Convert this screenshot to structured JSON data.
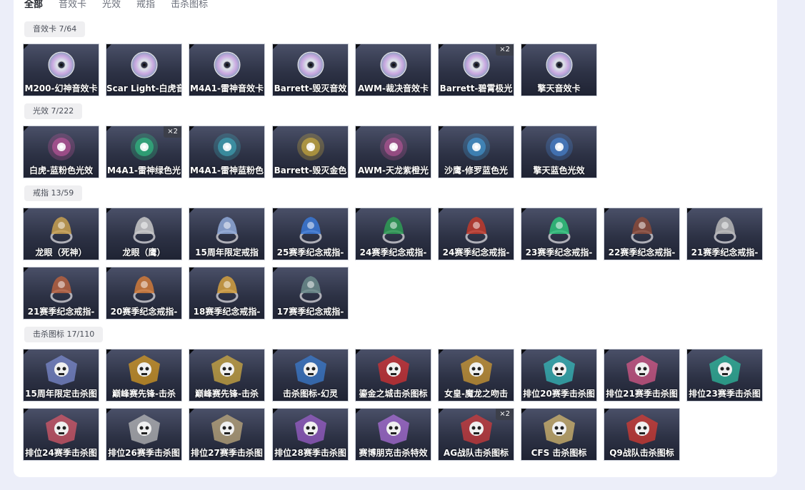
{
  "tabs": [
    {
      "label": "全部",
      "active": true
    },
    {
      "label": "音效卡",
      "active": false
    },
    {
      "label": "光效",
      "active": false
    },
    {
      "label": "戒指",
      "active": false
    },
    {
      "label": "击杀图标",
      "active": false
    }
  ],
  "sections": [
    {
      "label": "音效卡 7/64",
      "kind": "disc",
      "items": [
        {
          "name": "M200-幻神音效卡",
          "qty": ""
        },
        {
          "name": "Scar Light-白虎音",
          "qty": ""
        },
        {
          "name": "M4A1-雷神音效卡",
          "qty": ""
        },
        {
          "name": "Barrett-毁灭音效",
          "qty": ""
        },
        {
          "name": "AWM-裁决音效卡",
          "qty": ""
        },
        {
          "name": "Barrett-碧霄极光",
          "qty": "×2"
        },
        {
          "name": "擎天音效卡",
          "qty": ""
        }
      ]
    },
    {
      "label": "光效 7/222",
      "kind": "orb",
      "items": [
        {
          "name": "白虎-蓝粉色光效",
          "qty": "",
          "color": "#d45aa8"
        },
        {
          "name": "M4A1-雷神绿色光",
          "qty": "×2",
          "color": "#2fd28a"
        },
        {
          "name": "M4A1-雷神蓝粉色",
          "qty": "",
          "color": "#3fb7c9"
        },
        {
          "name": "Barrett-毁灭金色",
          "qty": "",
          "color": "#e6c03a"
        },
        {
          "name": "AWM-天龙紫橙光",
          "qty": "",
          "color": "#c95aa0"
        },
        {
          "name": "沙鹰-修罗蓝色光",
          "qty": "",
          "color": "#45a6e8"
        },
        {
          "name": "擎天蓝色光效",
          "qty": "",
          "color": "#4c8fe6"
        }
      ]
    },
    {
      "label": "戒指 13/59",
      "kind": "ring",
      "items": [
        {
          "name": "龙眼（死神）",
          "qty": "",
          "color": "#c8a050"
        },
        {
          "name": "龙眼（鹰）",
          "qty": "",
          "color": "#c9c9c9"
        },
        {
          "name": "15周年限定戒指",
          "qty": "",
          "color": "#8fa9d8"
        },
        {
          "name": "25赛季纪念戒指-",
          "qty": "",
          "color": "#3a78d6"
        },
        {
          "name": "24赛季纪念戒指-",
          "qty": "",
          "color": "#2e9c55"
        },
        {
          "name": "24赛季纪念戒指-",
          "qty": "",
          "color": "#c0392b"
        },
        {
          "name": "23赛季纪念戒指-",
          "qty": "",
          "color": "#2ec27a"
        },
        {
          "name": "22赛季纪念戒指-",
          "qty": "",
          "color": "#8a4a3a"
        },
        {
          "name": "21赛季纪念戒指-",
          "qty": "",
          "color": "#b8b8b8"
        },
        {
          "name": "21赛季纪念戒指-",
          "qty": "",
          "color": "#b5603f"
        },
        {
          "name": "20赛季纪念戒指-",
          "qty": "",
          "color": "#d07a3a"
        },
        {
          "name": "18赛季纪念戒指-",
          "qty": "",
          "color": "#d4a040"
        },
        {
          "name": "17赛季纪念戒指-",
          "qty": "",
          "color": "#6a8a8a"
        }
      ]
    },
    {
      "label": "击杀图标 17/110",
      "kind": "emblem",
      "items": [
        {
          "name": "15周年限定击杀图",
          "qty": "",
          "color": "#7f8fd6"
        },
        {
          "name": "巅峰赛先锋-击杀",
          "qty": "",
          "color": "#e0a020"
        },
        {
          "name": "巅峰赛先锋-击杀",
          "qty": "",
          "color": "#d8b040"
        },
        {
          "name": "击杀图标-幻灵",
          "qty": "",
          "color": "#3a7fd6"
        },
        {
          "name": "鎏金之城击杀图标",
          "qty": "",
          "color": "#e03030"
        },
        {
          "name": "女皇-魔龙之吻击",
          "qty": "",
          "color": "#d8a030"
        },
        {
          "name": "排位20赛季击杀图",
          "qty": "",
          "color": "#36c2c2"
        },
        {
          "name": "排位21赛季击杀图",
          "qty": "",
          "color": "#e05a8a"
        },
        {
          "name": "排位23赛季击杀图",
          "qty": "",
          "color": "#2ec2a2"
        },
        {
          "name": "排位24赛季击杀图",
          "qty": "",
          "color": "#e05a6a"
        },
        {
          "name": "排位26赛季击杀图",
          "qty": "",
          "color": "#c0c0c0"
        },
        {
          "name": "排位27赛季击杀图",
          "qty": "",
          "color": "#c8b080"
        },
        {
          "name": "排位28赛季击杀图",
          "qty": "",
          "color": "#a060d0"
        },
        {
          "name": "赛博朋克击杀特效",
          "qty": "",
          "color": "#b070e0"
        },
        {
          "name": "AG战队击杀图标",
          "qty": "×2",
          "color": "#d83a3a"
        },
        {
          "name": "CFS 击杀图标",
          "qty": "",
          "color": "#e0c070"
        },
        {
          "name": "Q9战队击杀图标",
          "qty": "",
          "color": "#e03a30"
        }
      ]
    }
  ]
}
